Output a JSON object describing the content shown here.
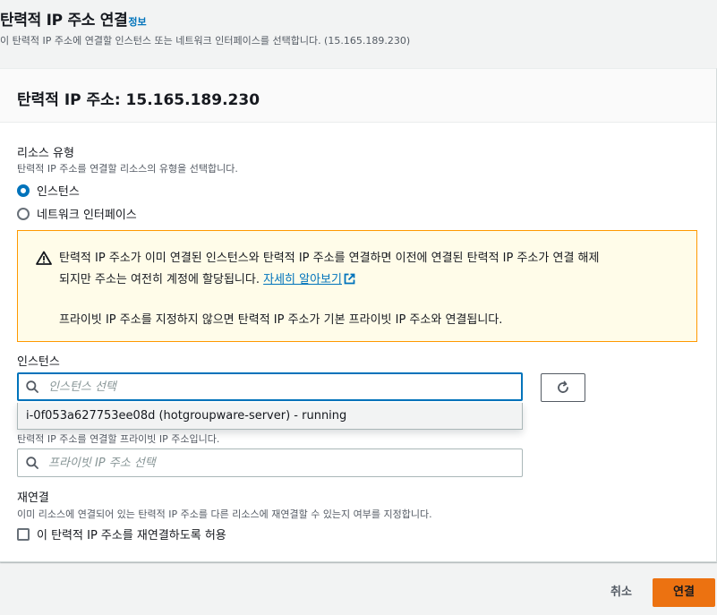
{
  "header": {
    "title": "탄력적 IP 주소 연결",
    "info_link": "정보",
    "description": "이 탄력적 IP 주소에 연결할 인스턴스 또는 네트워크 인터페이스를 선택합니다. (15.165.189.230)"
  },
  "panel": {
    "title": "탄력적 IP 주소: 15.165.189.230"
  },
  "resource_type": {
    "label": "리소스 유형",
    "description": "탄력적 IP 주소를 연결할 리소스의 유형을 선택합니다.",
    "options": [
      {
        "label": "인스턴스",
        "checked": true
      },
      {
        "label": "네트워크 인터페이스",
        "checked": false
      }
    ]
  },
  "alert": {
    "line1": "탄력적 IP 주소가 이미 연결된 인스턴스와 탄력적 IP 주소를 연결하면 이전에 연결된 탄력적 IP 주소가 연결 해제",
    "line2_prefix": "되지만 주소는 여전히 계정에 할당됩니다.",
    "link": "자세히 알아보기",
    "line3": "프라이빗 IP 주소를 지정하지 않으면 탄력적 IP 주소가 기본 프라이빗 IP 주소와 연결됩니다.",
    "colors": {
      "border": "#ff9900",
      "background": "#fffce9",
      "icon": "#16191f"
    }
  },
  "instance": {
    "label": "인스턴스",
    "placeholder": "인스턴스 선택",
    "dropdown_options": [
      "i-0f053a627753ee08d (hotgroupware-server) - running"
    ]
  },
  "private_ip": {
    "description": "탄력적 IP 주소를 연결할 프라이빗 IP 주소입니다.",
    "placeholder": "프라이빗 IP 주소 선택"
  },
  "reassociation": {
    "label": "재연결",
    "description": "이미 리소스에 연결되어 있는 탄력적 IP 주소를 다른 리소스에 재연결할 수 있는지 여부를 지정합니다.",
    "checkbox_label": "이 탄력적 IP 주소를 재연결하도록 허용",
    "checked": false
  },
  "footer": {
    "cancel": "취소",
    "submit": "연결"
  },
  "colors": {
    "accent": "#0073bb",
    "primary_button": "#ec7211"
  }
}
